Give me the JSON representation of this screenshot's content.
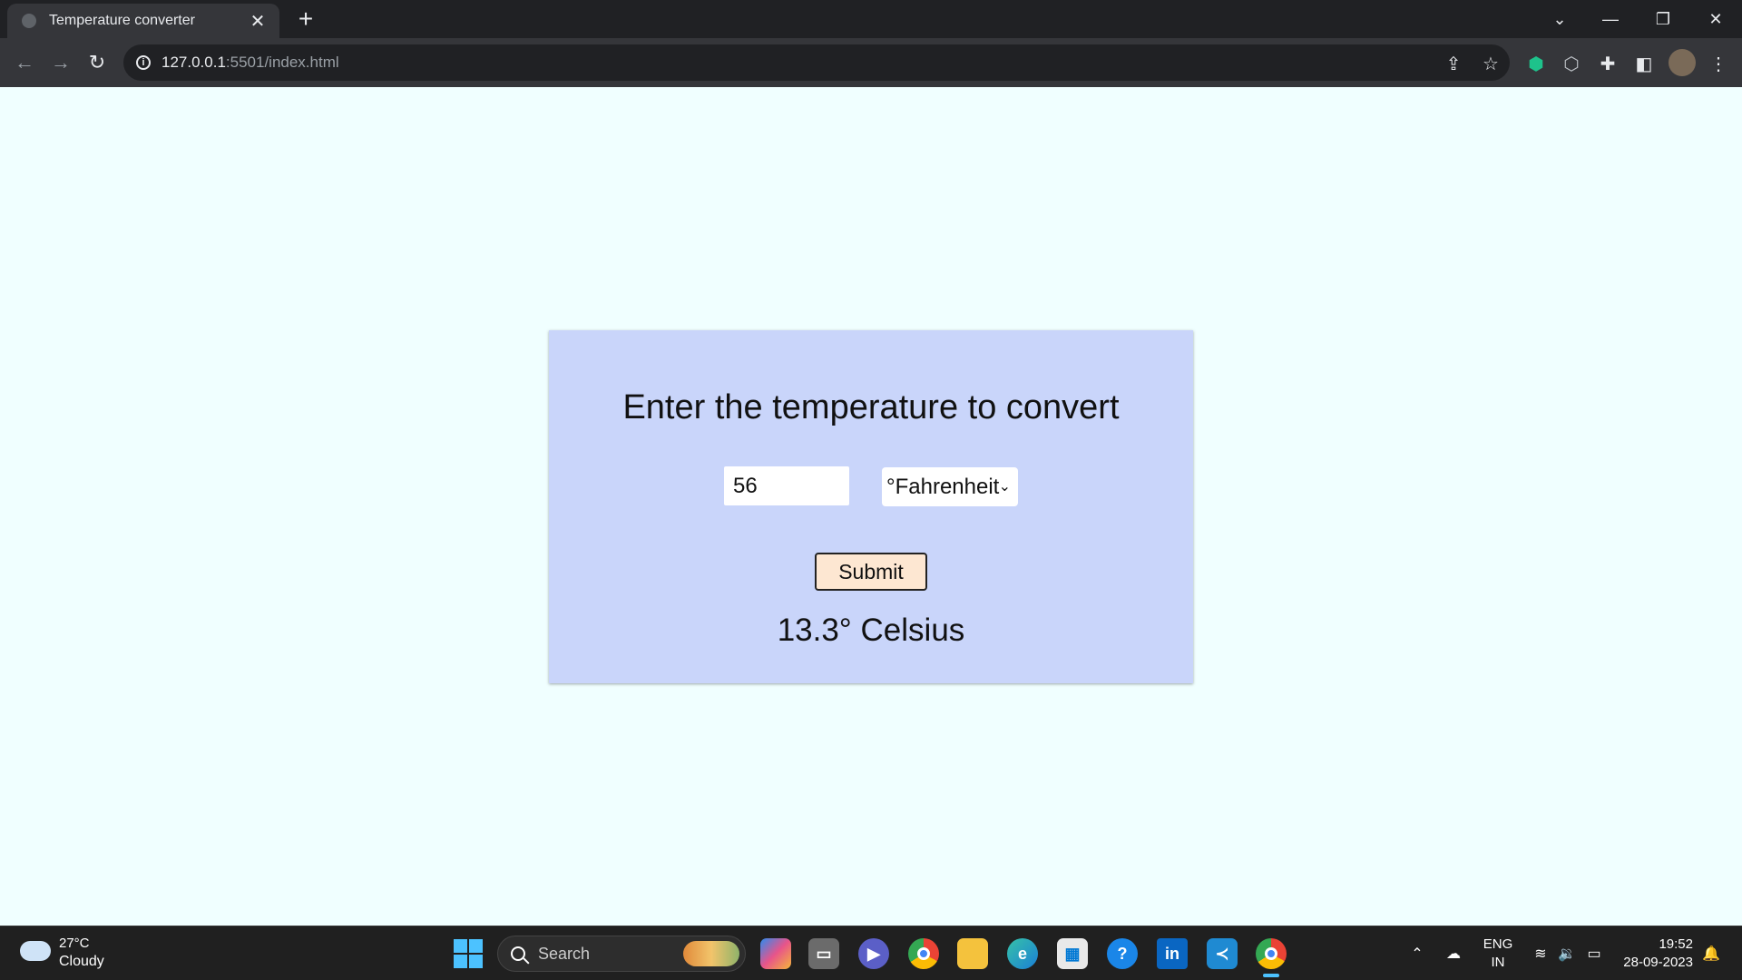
{
  "browser": {
    "tab_title": "Temperature converter",
    "tab_close": "✕",
    "new_tab": "+",
    "url_host": "127.0.0.1",
    "url_rest": ":5501/index.html",
    "controls": {
      "tab_search": "⌄",
      "minimize": "—",
      "restore": "❐",
      "close": "✕"
    },
    "toolbar_icons": [
      "share-icon",
      "star-icon",
      "shield-extension-icon",
      "extension-icon",
      "puzzle-icon",
      "side-panel-icon",
      "profile-avatar",
      "menu-icon"
    ]
  },
  "page": {
    "heading": "Enter the temperature to convert",
    "input_value": "56",
    "unit_selected": "°Fahrenheit",
    "submit_label": "Submit",
    "result": "13.3° Celsius"
  },
  "taskbar": {
    "weather_temp": "27°C",
    "weather_condition": "Cloudy",
    "search_label": "Search",
    "apps": [
      "copilot-icon",
      "task-view-icon",
      "teams-icon",
      "chrome-icon",
      "file-explorer-icon",
      "edge-icon",
      "store-icon",
      "help-icon",
      "linkedin-icon",
      "vscode-icon",
      "chrome-active-icon"
    ],
    "lang_line1": "ENG",
    "lang_line2": "IN",
    "time": "19:52",
    "date": "28-09-2023"
  },
  "colors": {
    "page_background": "#f0ffff",
    "card_background": "#c9d5fa",
    "submit_background": "#fde7d2",
    "chrome_dark": "#202124",
    "accent": "#4cc2ff"
  }
}
